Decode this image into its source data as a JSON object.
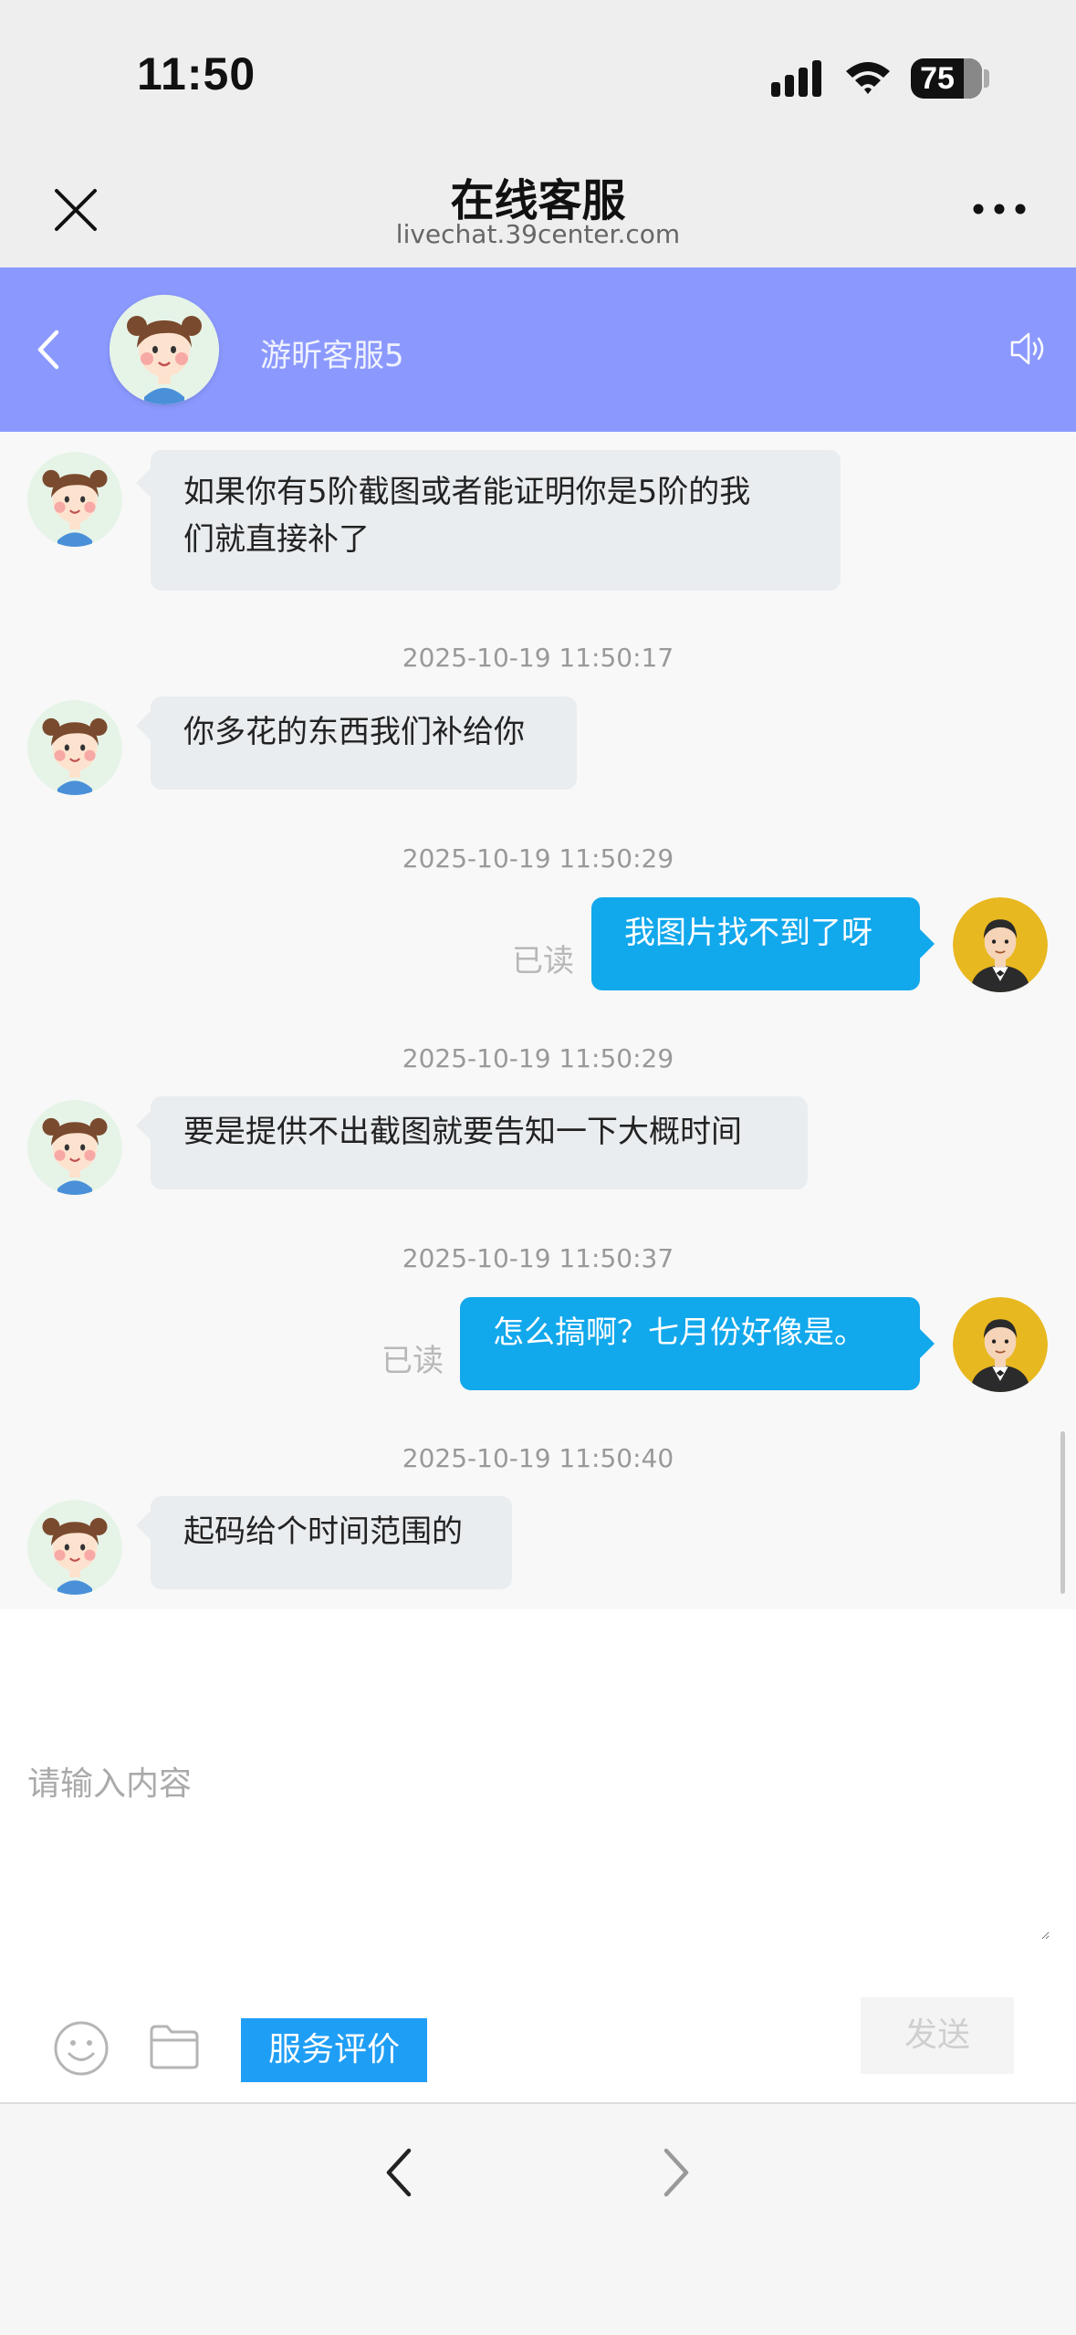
{
  "status_bar": {
    "time": "11:50",
    "battery": "75",
    "icons": [
      "signal-icon",
      "wifi-icon",
      "battery-icon"
    ]
  },
  "browser": {
    "title": "在线客服",
    "url": "livechat.39center.com",
    "icons": [
      "close-icon",
      "more-icon"
    ]
  },
  "chat_header": {
    "agent_name": "游昕客服5",
    "background_color": "#8b99ff",
    "icons": [
      "back-icon",
      "speaker-icon"
    ]
  },
  "messages": [
    {
      "from": "agent",
      "text_line1": "如果你有5阶截图或者能证明你是5阶的我",
      "text_line2": "们就直接补了"
    },
    {
      "timestamp": "2025-10-19 11:50:17",
      "from": "agent",
      "text": "你多花的东西我们补给你"
    },
    {
      "timestamp": "2025-10-19 11:50:29",
      "from": "user",
      "text": "我图片找不到了呀",
      "status": "已读"
    },
    {
      "timestamp": "2025-10-19 11:50:29",
      "from": "agent",
      "text": "要是提供不出截图就要告知一下大概时间"
    },
    {
      "timestamp": "2025-10-19 11:50:37",
      "from": "user",
      "text": "怎么搞啊？七月份好像是。",
      "status": "已读"
    },
    {
      "timestamp": "2025-10-19 11:50:40",
      "from": "agent",
      "text": "起码给个时间范围的"
    }
  ],
  "colors": {
    "user_bubble": "#12a8ec",
    "agent_bubble": "#e9edf0",
    "rate_button": "#1f9ef5"
  },
  "input": {
    "placeholder": "请输入内容",
    "value": ""
  },
  "toolbar": {
    "rate_label": "服务评价",
    "send_label": "发送",
    "icons": [
      "emoji-icon",
      "folder-icon"
    ]
  },
  "bottom_nav": {
    "icons": [
      "nav-back-icon",
      "nav-forward-icon"
    ]
  }
}
